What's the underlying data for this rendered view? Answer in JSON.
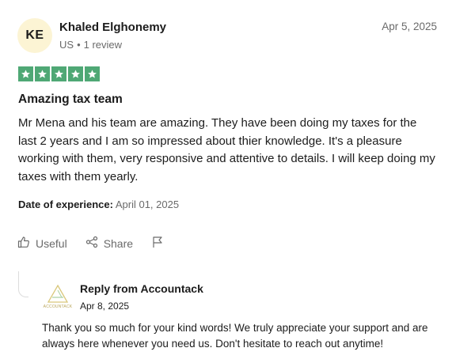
{
  "review": {
    "avatar_initials": "KE",
    "reviewer_name": "Khaled Elghonemy",
    "country": "US",
    "review_count": "1 review",
    "separator": "•",
    "date": "Apr 5, 2025",
    "rating": 5,
    "star_color": "#4fa875",
    "title": "Amazing tax team",
    "body": "Mr Mena and his team are amazing. They have been doing my taxes for the last 2 years and I am so impressed about thier knowledge. It's a pleasure working with them, very responsive and attentive to details. I will keep doing my taxes with them yearly.",
    "experience_label": "Date of experience:",
    "experience_date": "April 01, 2025"
  },
  "actions": {
    "useful_label": "Useful",
    "useful_icon": "thumbs-up-icon",
    "share_label": "Share",
    "share_icon": "share-icon",
    "flag_icon": "flag-icon"
  },
  "reply": {
    "from_label": "Reply from Accountack",
    "date": "Apr 8, 2025",
    "logo_text": "ACCOUNTACK",
    "text": "Thank you so much for your kind words! We truly appreciate your support and are always here whenever you need us. Don't hesitate to reach out anytime!"
  }
}
